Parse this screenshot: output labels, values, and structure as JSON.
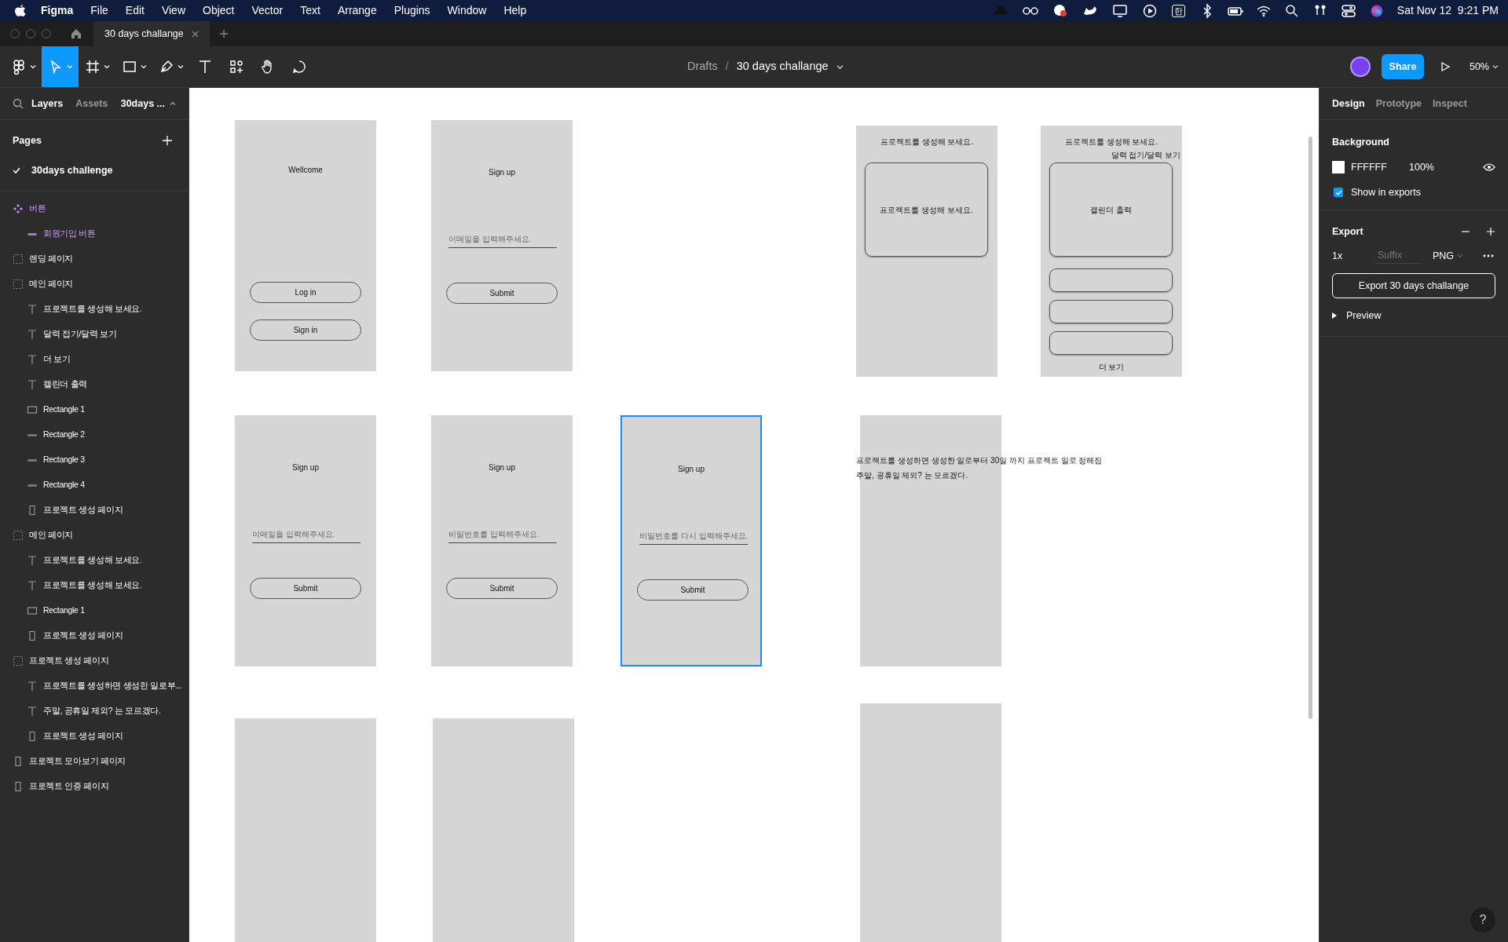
{
  "menu_bar": {
    "app": "Figma",
    "menus": [
      "File",
      "Edit",
      "View",
      "Object",
      "Vector",
      "Text",
      "Arrange",
      "Plugins",
      "Window",
      "Help"
    ],
    "input_source": "한",
    "clock": "Sat Nov 12  9:21 PM"
  },
  "tab_bar": {
    "tabs": [
      {
        "label": "30 days challange",
        "selected": true
      }
    ]
  },
  "toolbar": {
    "tools": [
      {
        "kind": "main-menu",
        "selected": false
      },
      {
        "kind": "move",
        "selected": true
      },
      {
        "kind": "frame",
        "selected": false
      },
      {
        "kind": "shape",
        "selected": false
      },
      {
        "kind": "pen",
        "selected": false
      },
      {
        "kind": "text",
        "selected": false
      },
      {
        "kind": "resources",
        "selected": false
      },
      {
        "kind": "hand",
        "selected": false
      },
      {
        "kind": "comment",
        "selected": false
      }
    ],
    "breadcrumb": "Drafts",
    "separator": "/",
    "file_name": "30 days challange",
    "share": "Share",
    "zoom": "50%"
  },
  "left_panel": {
    "tabs": [
      {
        "label": "Layers",
        "selected": true
      },
      {
        "label": "Assets",
        "selected": false
      }
    ],
    "page_menu": "30days ...",
    "pages_title": "Pages",
    "pages": [
      {
        "label": "30days challenge",
        "selected": true
      }
    ],
    "layers": [
      {
        "label": "버튼",
        "kind": "component",
        "children": [
          {
            "label": "회원기입 버튼",
            "kind": "instance"
          }
        ]
      },
      {
        "label": "렌딩 페이지",
        "kind": "section"
      },
      {
        "label": "메인 페이지",
        "kind": "section",
        "children": [
          {
            "label": "프로젝트를 생성해 보세요.",
            "kind": "text"
          },
          {
            "label": "달력 접기/달력 보기",
            "kind": "text"
          },
          {
            "label": "더 보기",
            "kind": "text"
          },
          {
            "label": "캘린더 출력",
            "kind": "text"
          },
          {
            "label": "Rectangle 1",
            "kind": "rectangle"
          },
          {
            "label": "Rectangle 2",
            "kind": "bar"
          },
          {
            "label": "Rectangle 3",
            "kind": "bar"
          },
          {
            "label": "Rectangle 4",
            "kind": "bar"
          },
          {
            "label": "프로젝트 생성 페이지",
            "kind": "device"
          }
        ]
      },
      {
        "label": "메인 페이지",
        "kind": "section",
        "children": [
          {
            "label": "프로젝트를 생성해 보세요.",
            "kind": "text"
          },
          {
            "label": "프로젝트를 생성해 보세요.",
            "kind": "text"
          },
          {
            "label": "Rectangle 1",
            "kind": "rectangle"
          },
          {
            "label": "프로젝트 생성 페이지",
            "kind": "device"
          }
        ]
      },
      {
        "label": "프로젝트 생성 페이지",
        "kind": "section",
        "children": [
          {
            "label": "프로젝트를 생성하면 생성한 일로부...",
            "kind": "text"
          },
          {
            "label": "주말, 공휴일 제외? 는 모르겠다.",
            "kind": "text"
          },
          {
            "label": "프로젝트 생성 페이지",
            "kind": "device"
          }
        ]
      },
      {
        "label": "프로젝트 모아보기 페이지",
        "kind": "device"
      },
      {
        "label": "프로젝트 인증 페이지",
        "kind": "device"
      }
    ]
  },
  "canvas": {
    "frames": [
      {
        "kind": "login",
        "selected": false,
        "title": "Wellcome",
        "buttons": [
          "Log in",
          "Sign in"
        ]
      },
      {
        "kind": "form",
        "selected": false,
        "title": "Sign up",
        "placeholder": "이메일을 입력해주세요.",
        "button": "Submit"
      },
      {
        "kind": "main",
        "selected": false,
        "title": "프로젝트를 생성해 보세요.",
        "card": "프로젝트를 생성해 보세요."
      },
      {
        "kind": "calendar",
        "selected": false,
        "title": "프로젝트를 생성해 보세요.",
        "toggle": "달력 접기/달력 보기",
        "card": "캘린더 출력",
        "list_cards": [
          {
            "kind": "empty"
          },
          {
            "kind": "empty"
          },
          {
            "kind": "empty"
          }
        ],
        "more": "더 보기"
      },
      {
        "kind": "form",
        "selected": false,
        "title": "Sign up",
        "placeholder": "이메일을 입력해주세요.",
        "button": "Submit"
      },
      {
        "kind": "form",
        "selected": false,
        "title": "Sign up",
        "placeholder": "비밀번호를 입력해주세요.",
        "button": "Submit"
      },
      {
        "kind": "form",
        "selected": true,
        "title": "Sign up",
        "placeholder": "비밀번호를 다시 입력해주세요.",
        "button": "Submit"
      },
      {
        "kind": "note",
        "selected": false,
        "lines": [
          "프로젝트를 생성하면 생성한 일로부터 30일 까지 프로젝트 일로 정해짐",
          "주말, 공휴일 제외? 는 모르겠다."
        ]
      },
      {
        "kind": "blank",
        "selected": false
      },
      {
        "kind": "blank",
        "selected": false
      },
      {
        "kind": "blank",
        "selected": false
      }
    ]
  },
  "right_panel": {
    "tabs": [
      {
        "label": "Design",
        "selected": true
      },
      {
        "label": "Prototype",
        "selected": false
      },
      {
        "label": "Inspect",
        "selected": false
      }
    ],
    "background": {
      "title": "Background",
      "hex": "FFFFFF",
      "opacity": "100%",
      "show_in_exports": {
        "label": "Show in exports",
        "checked": true
      }
    },
    "export": {
      "title": "Export",
      "scale": "1x",
      "suffix": {
        "placeholder": "Suffix"
      },
      "format": "PNG",
      "button": "Export 30 days challange",
      "preview": "Preview"
    },
    "help": "?"
  }
}
